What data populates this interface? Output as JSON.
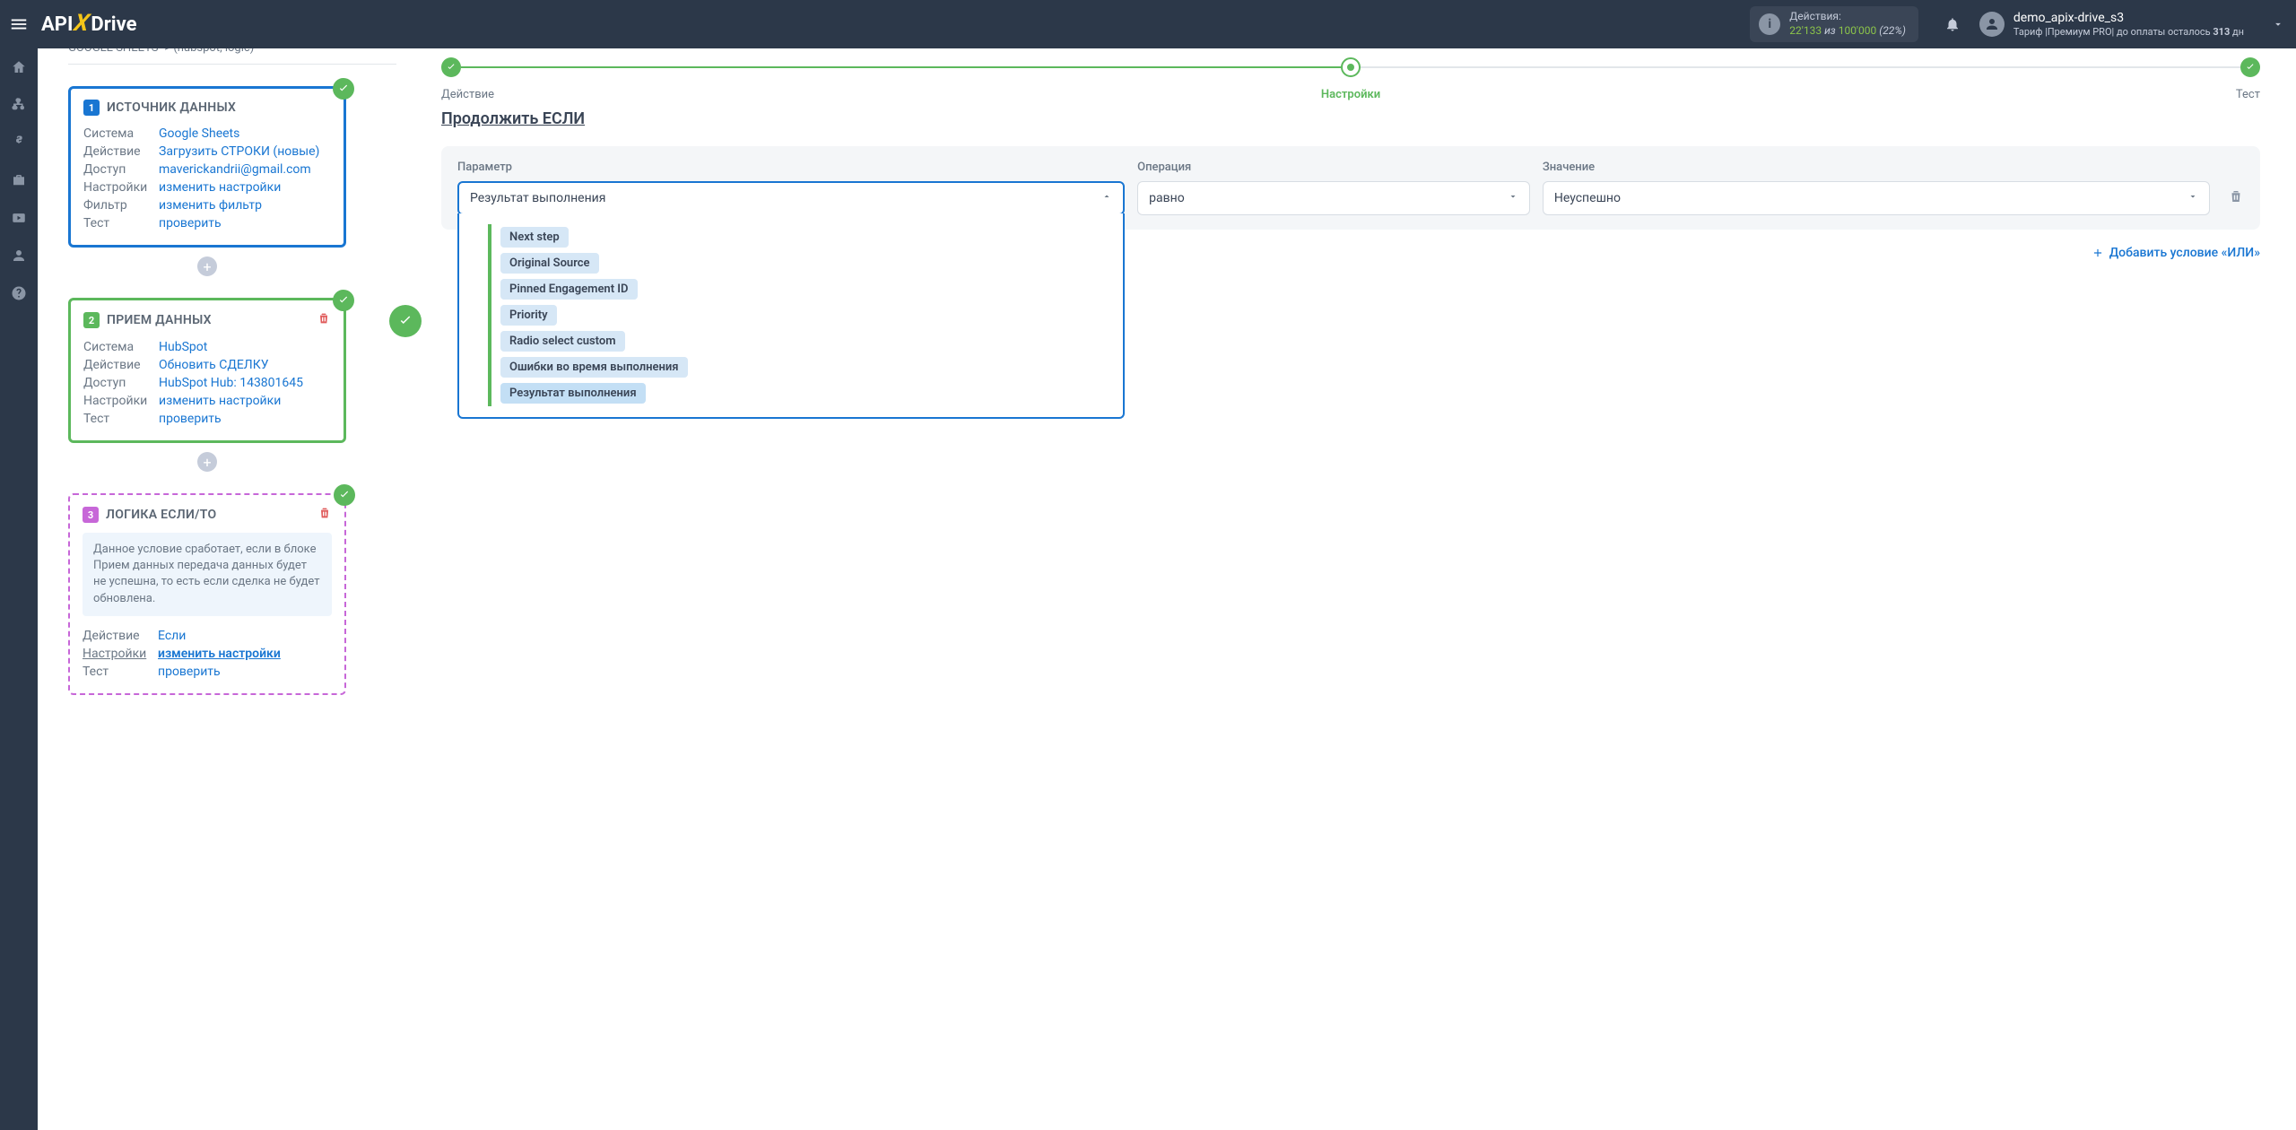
{
  "header": {
    "actions_label": "Действия:",
    "actions_used": "22'133",
    "actions_iz": "из",
    "actions_total": "100'000",
    "actions_pct": "(22%)",
    "user_name": "demo_apix-drive_s3",
    "tariff_prefix": "Тариф |",
    "tariff_name": "Премиум PRO",
    "tariff_suffix": "| до оплаты осталось",
    "tariff_days": "313",
    "tariff_days_unit": "дн"
  },
  "left": {
    "connection_title": "GOOGLE SHEETS -> (hubspot, logic)",
    "card1": {
      "num": "1",
      "title": "ИСТОЧНИК ДАННЫХ",
      "rows": {
        "system_lbl": "Система",
        "system_val": "Google Sheets",
        "action_lbl": "Действие",
        "action_val": "Загрузить СТРОКИ (новые)",
        "access_lbl": "Доступ",
        "access_val": "maverickandrii@gmail.com",
        "settings_lbl": "Настройки",
        "settings_val": "изменить настройки",
        "filter_lbl": "Фильтр",
        "filter_val": "изменить фильтр",
        "test_lbl": "Тест",
        "test_val": "проверить"
      }
    },
    "card2": {
      "num": "2",
      "title": "ПРИЕМ ДАННЫХ",
      "rows": {
        "system_lbl": "Система",
        "system_val": "HubSpot",
        "action_lbl": "Действие",
        "action_val": "Обновить СДЕЛКУ",
        "access_lbl": "Доступ",
        "access_val": "HubSpot Hub: 143801645",
        "settings_lbl": "Настройки",
        "settings_val": "изменить настройки",
        "test_lbl": "Тест",
        "test_val": "проверить"
      }
    },
    "card3": {
      "num": "3",
      "title": "ЛОГИКА ЕСЛИ/ТО",
      "note": "Данное условие сработает, если в блоке Прием данных передача данных будет не успешна, то есть если сделка не будет обновлена.",
      "rows": {
        "action_lbl": "Действие",
        "action_val": "Если",
        "settings_lbl": "Настройки",
        "settings_val": "изменить настройки",
        "test_lbl": "Тест",
        "test_val": "проверить"
      }
    }
  },
  "right": {
    "step1": "Действие",
    "step2": "Настройки",
    "step3": "Тест",
    "section_title": "Продолжить ЕСЛИ",
    "param_label": "Параметр",
    "op_label": "Операция",
    "val_label": "Значение",
    "param_value": "Результат выполнения",
    "op_value": "равно",
    "val_value": "Неуспешно",
    "dropdown": [
      "Next step",
      "Original Source",
      "Pinned Engagement ID",
      "Priority",
      "Radio select custom",
      "Ошибки во время выполнения",
      "Результат выполнения"
    ],
    "add_or": "Добавить условие «ИЛИ»"
  }
}
